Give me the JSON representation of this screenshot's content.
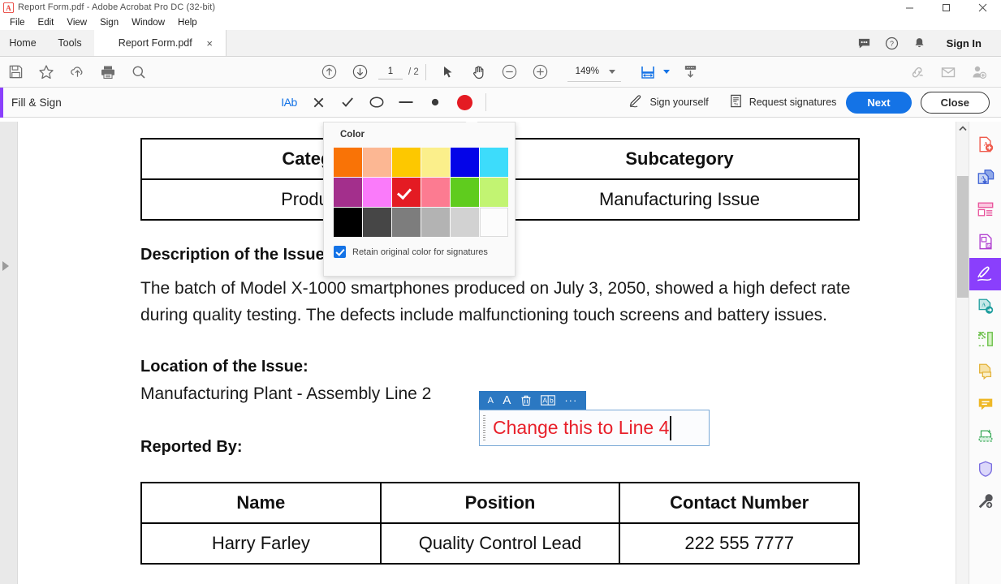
{
  "window": {
    "title": "Report Form.pdf - Adobe Acrobat Pro DC (32-bit)",
    "minimize": "minimize-icon",
    "maximize": "maximize-icon",
    "close": "close-icon"
  },
  "menubar": {
    "items": [
      "File",
      "Edit",
      "View",
      "Sign",
      "Window",
      "Help"
    ]
  },
  "tabstrip": {
    "home": "Home",
    "tools": "Tools",
    "doc_tab": "Report Form.pdf",
    "doc_tab_close": "×",
    "right_icons": [
      "comment-bubble-icon",
      "help-question-icon",
      "bell-notification-icon"
    ],
    "sign_in": "Sign In"
  },
  "toolbar": {
    "left_icons": [
      "save-icon",
      "star-icon",
      "upload-cloud-icon",
      "print-icon",
      "search-icon"
    ],
    "prev_page_icon": "arrow-up-circle-icon",
    "next_page_icon": "arrow-down-circle-icon",
    "page_current": "1",
    "page_total": "/ 2",
    "select_icon": "cursor-select-icon",
    "hand_icon": "hand-pan-icon",
    "zoom_out_icon": "zoom-out-icon",
    "zoom_in_icon": "zoom-in-icon",
    "zoom_value": "149%",
    "fit_icon": "fit-page-icon",
    "scroll_mode_icon": "page-scroll-icon",
    "right_icons": [
      "link-share-icon",
      "email-icon",
      "add-person-icon"
    ]
  },
  "fill_sign_bar": {
    "title": "Fill & Sign",
    "tools": [
      {
        "name": "add-text-tool",
        "glyph": "IAb"
      },
      {
        "name": "cross-mark-tool",
        "glyph": "×"
      },
      {
        "name": "check-mark-tool",
        "glyph": "✓"
      },
      {
        "name": "circle-tool",
        "glyph": "○"
      },
      {
        "name": "line-tool",
        "glyph": "—"
      },
      {
        "name": "dot-tool",
        "glyph": "●"
      },
      {
        "name": "color-picker-tool",
        "glyph": ""
      }
    ],
    "current_color": "#e41b23",
    "sign_yourself": "Sign yourself",
    "request_signatures": "Request signatures",
    "next": "Next",
    "close": "Close"
  },
  "color_popup": {
    "label": "Color",
    "swatches": [
      {
        "name": "orange",
        "hex": "#f97306"
      },
      {
        "name": "peach",
        "hex": "#fcb793"
      },
      {
        "name": "gold",
        "hex": "#fdc800"
      },
      {
        "name": "pale-yellow",
        "hex": "#fbef8b"
      },
      {
        "name": "blue",
        "hex": "#0404e8"
      },
      {
        "name": "cyan",
        "hex": "#3ddcfb"
      },
      {
        "name": "purple",
        "hex": "#a32f8c"
      },
      {
        "name": "magenta",
        "hex": "#fa7bfa"
      },
      {
        "name": "red",
        "hex": "#e41b23"
      },
      {
        "name": "pink",
        "hex": "#fc7b91"
      },
      {
        "name": "green",
        "hex": "#5fcc1e"
      },
      {
        "name": "light-green",
        "hex": "#c2f472"
      },
      {
        "name": "black",
        "hex": "#000000"
      },
      {
        "name": "dark-gray",
        "hex": "#464646"
      },
      {
        "name": "gray",
        "hex": "#7d7d7d"
      },
      {
        "name": "medium-gray",
        "hex": "#b3b3b3"
      },
      {
        "name": "light-gray",
        "hex": "#d2d2d2"
      },
      {
        "name": "white",
        "hex": "#fcfcfc"
      }
    ],
    "selected_index": 8,
    "retain_checkbox_checked": true,
    "retain_label": "Retain original color for signatures"
  },
  "document": {
    "table_category": {
      "headers": [
        "Category",
        "Subcategory"
      ],
      "rows": [
        [
          "Product D",
          "Manufacturing Issue"
        ]
      ]
    },
    "description_heading": "Description of the Issue",
    "description_body": "The batch of Model X-1000 smartphones produced on July 3, 2050, showed a high defect rate during quality testing. The defects include malfunctioning touch screens and battery issues.",
    "location_heading": "Location of the Issue:",
    "location_value": "Manufacturing Plant - Assembly Line 2",
    "reported_by_heading": "Reported By:",
    "table_reported": {
      "headers": [
        "Name",
        "Position",
        "Contact Number"
      ],
      "rows": [
        [
          "Harry Farley",
          "Quality Control Lead",
          "222 555 7777"
        ]
      ]
    }
  },
  "text_field": {
    "value": "Change this to Line 4",
    "text_color": "#e8202a",
    "toolbar_buttons": [
      {
        "name": "decrease-font-size-button",
        "glyph": "A"
      },
      {
        "name": "increase-font-size-button",
        "glyph": "A"
      },
      {
        "name": "delete-field-button",
        "glyph": "trash-icon"
      },
      {
        "name": "text-color-button",
        "glyph": "Ab"
      },
      {
        "name": "more-options-button",
        "glyph": "···"
      }
    ]
  },
  "right_rail": {
    "items": [
      {
        "name": "create-pdf-icon",
        "color": "#ef5a4c"
      },
      {
        "name": "combine-files-icon",
        "color": "#3b5fd4"
      },
      {
        "name": "organize-pages-icon",
        "color": "#e8509a"
      },
      {
        "name": "export-pdf-icon",
        "color": "#b03fd0"
      },
      {
        "name": "fill-and-sign-icon",
        "color": "#ffffff"
      },
      {
        "name": "send-for-comments-icon",
        "color": "#1f9e9e"
      },
      {
        "name": "compress-pdf-icon",
        "color": "#6cc04a"
      },
      {
        "name": "edit-pdf-icon",
        "color": "#e3b33b"
      },
      {
        "name": "comment-icon",
        "color": "#e8a82a"
      },
      {
        "name": "scan-and-ocr-icon",
        "color": "#3caa5a"
      },
      {
        "name": "protect-icon",
        "color": "#7b6fe0"
      },
      {
        "name": "more-tools-icon",
        "color": "#55565a"
      }
    ],
    "active_index": 4
  },
  "scrollbar": {
    "up_arrow": "scroll-up-arrow-icon"
  }
}
